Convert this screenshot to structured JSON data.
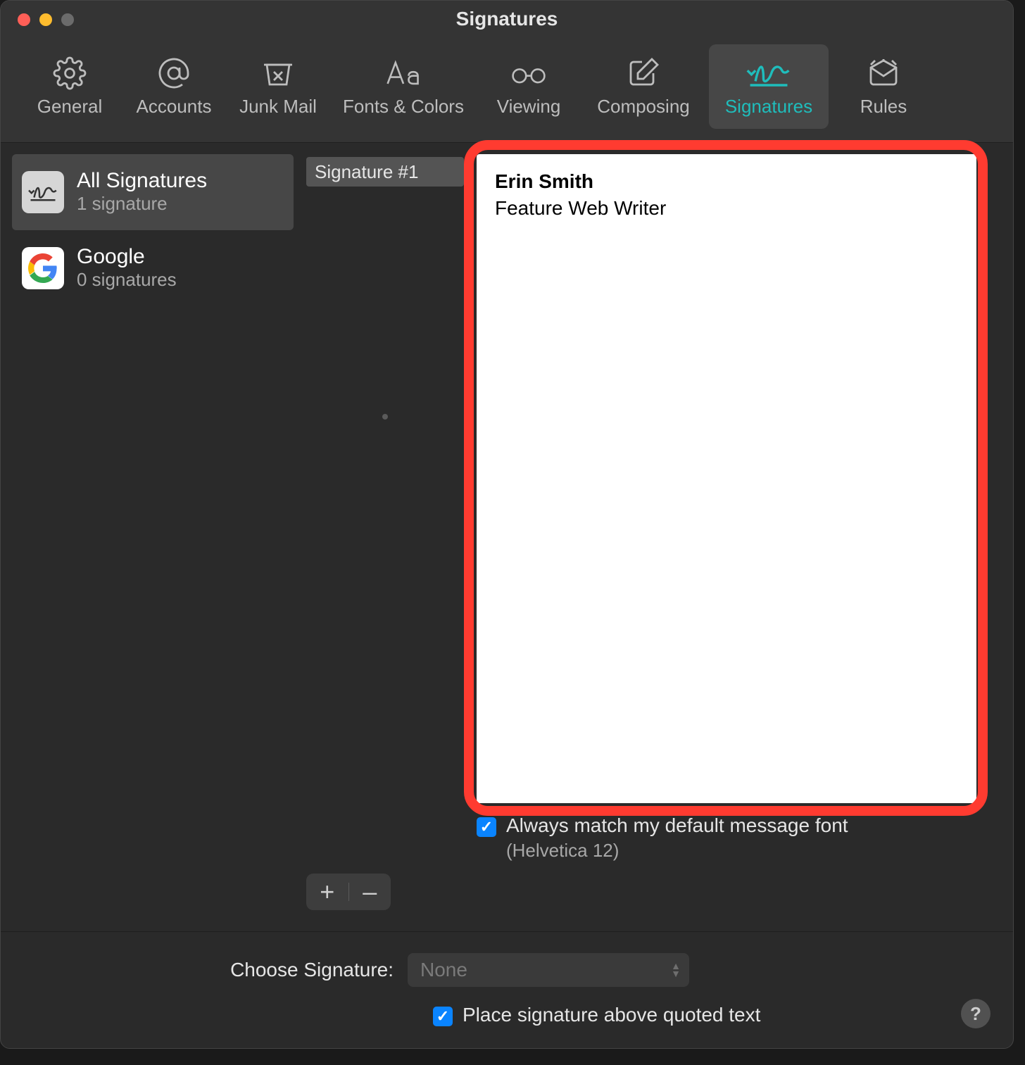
{
  "window": {
    "title": "Signatures"
  },
  "toolbar": {
    "items": [
      {
        "label": "General"
      },
      {
        "label": "Accounts"
      },
      {
        "label": "Junk Mail"
      },
      {
        "label": "Fonts & Colors"
      },
      {
        "label": "Viewing"
      },
      {
        "label": "Composing"
      },
      {
        "label": "Signatures"
      },
      {
        "label": "Rules"
      }
    ]
  },
  "sidebar": {
    "items": [
      {
        "name": "All Signatures",
        "count": "1 signature"
      },
      {
        "name": "Google",
        "count": "0 signatures"
      }
    ]
  },
  "signature_list": {
    "items": [
      {
        "name": "Signature #1"
      }
    ]
  },
  "buttons": {
    "plus": "+",
    "minus": "–"
  },
  "editor": {
    "name": "Erin Smith",
    "subtitle": "Feature Web Writer"
  },
  "options": {
    "match_font_label": "Always match my default message font",
    "match_font_sub": "(Helvetica 12)",
    "match_font_checked": true,
    "choose_label": "Choose Signature:",
    "choose_value": "None",
    "place_above_label": "Place signature above quoted text",
    "place_above_checked": true,
    "help": "?"
  }
}
